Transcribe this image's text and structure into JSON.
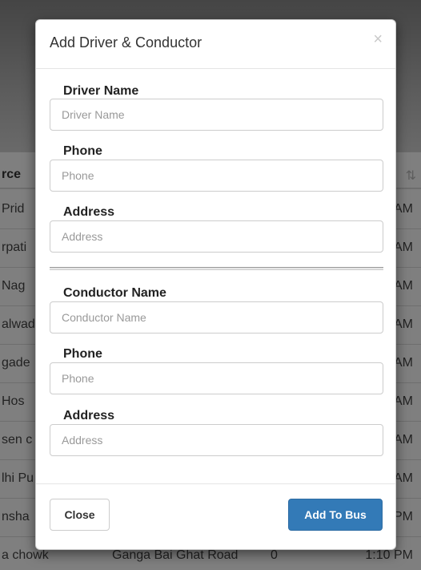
{
  "background": {
    "header_left": "rce",
    "header_right": "⇅",
    "rows": [
      {
        "c1": "Prid",
        "c4": "AM"
      },
      {
        "c1": "rpati",
        "c4": "AM"
      },
      {
        "c1": "Nag",
        "c4": "AM"
      },
      {
        "c1": "alwad",
        "c4": "AM"
      },
      {
        "c1": "gade",
        "c4": "AM"
      },
      {
        "c1": "Hos",
        "c4": "AM"
      },
      {
        "c1": "sen c",
        "c4": "AM"
      },
      {
        "c1": "lhi Pu",
        "c4": "AM"
      },
      {
        "c1": "nsha",
        "c4": "PM"
      },
      {
        "c1": "a chowk",
        "c2": "Ganga Bai Ghat Road",
        "c3": "0",
        "c4": "1:10 PM"
      }
    ]
  },
  "modal": {
    "title": "Add Driver & Conductor",
    "close_symbol": "×",
    "driver": {
      "name_label": "Driver Name",
      "name_placeholder": "Driver Name",
      "phone_label": "Phone",
      "phone_placeholder": "Phone",
      "address_label": "Address",
      "address_placeholder": "Address"
    },
    "conductor": {
      "name_label": "Conductor Name",
      "name_placeholder": "Conductor Name",
      "phone_label": "Phone",
      "phone_placeholder": "Phone",
      "address_label": "Address",
      "address_placeholder": "Address"
    },
    "footer": {
      "close_label": "Close",
      "add_label": "Add To Bus"
    }
  }
}
